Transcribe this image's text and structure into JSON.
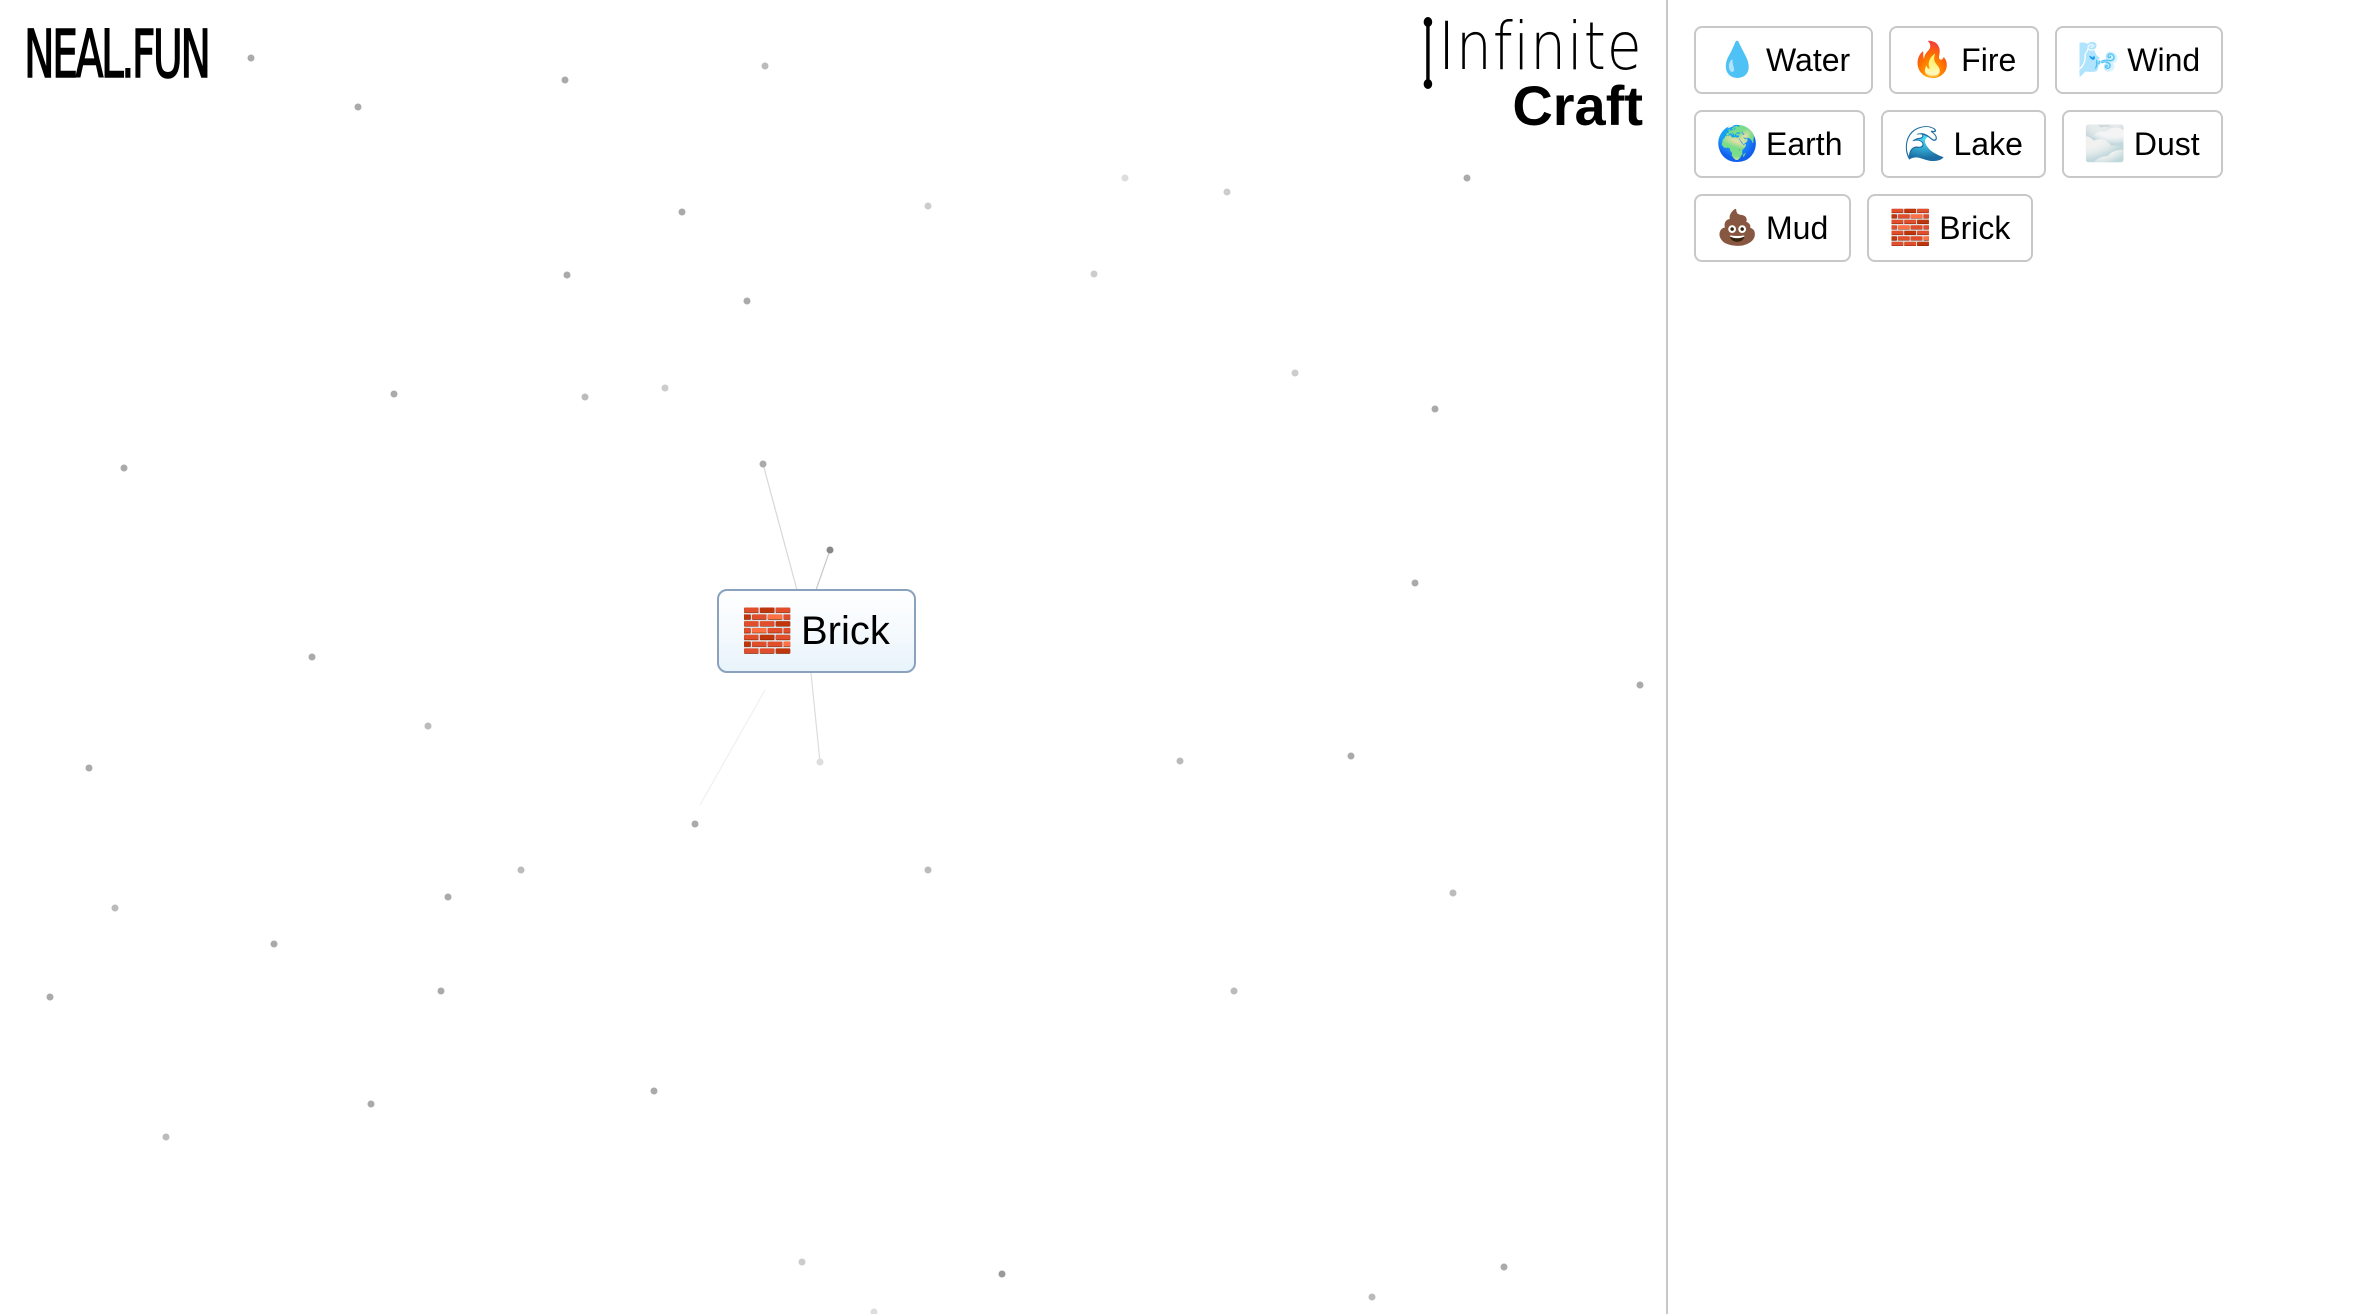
{
  "header": {
    "logo": "NEAL.FUN",
    "title_line1": "Infinite",
    "title_line2": "Craft"
  },
  "sidebar": {
    "items": [
      {
        "emoji": "💧",
        "icon": "water-drop-icon",
        "label": "Water"
      },
      {
        "emoji": "🔥",
        "icon": "fire-icon",
        "label": "Fire"
      },
      {
        "emoji": "🌬️",
        "icon": "wind-face-icon",
        "label": "Wind"
      },
      {
        "emoji": "🌍",
        "icon": "earth-globe-icon",
        "label": "Earth"
      },
      {
        "emoji": "🌊",
        "icon": "wave-icon",
        "label": "Lake"
      },
      {
        "emoji": "🌫️",
        "icon": "fog-icon",
        "label": "Dust"
      },
      {
        "emoji": "💩",
        "icon": "poop-icon",
        "label": "Mud"
      },
      {
        "emoji": "🧱",
        "icon": "brick-icon",
        "label": "Brick"
      }
    ]
  },
  "canvas": {
    "items": [
      {
        "emoji": "🧱",
        "icon": "brick-icon",
        "label": "Brick"
      }
    ]
  },
  "colors": {
    "divider": "#c8c8c8",
    "item_border": "#c8c8c8",
    "canvas_item_border": "#8aa2bd",
    "particle": "#9e9e9e"
  }
}
